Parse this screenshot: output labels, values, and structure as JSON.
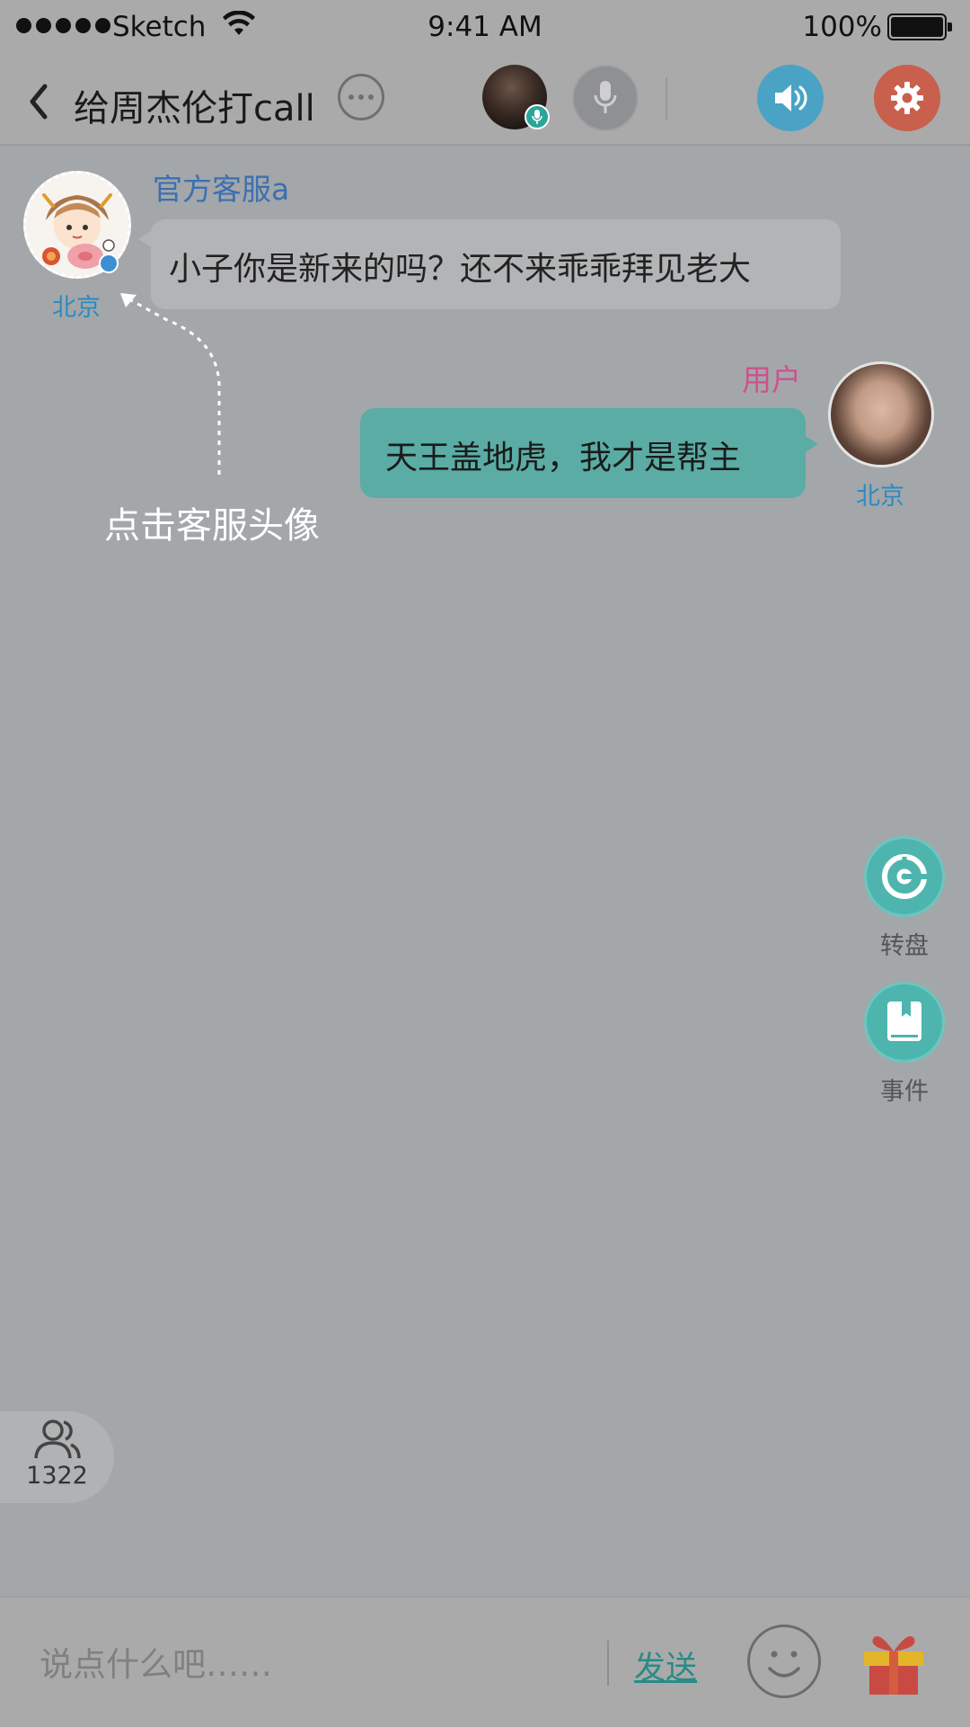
{
  "status_bar": {
    "carrier": "Sketch",
    "time": "9:41 AM",
    "battery": "100%"
  },
  "nav": {
    "title": "给周杰伦打call",
    "icons": [
      "back-icon",
      "more-icon",
      "host-avatar",
      "mic-icon",
      "speaker-icon",
      "gear-icon"
    ]
  },
  "messages": [
    {
      "sender": "官方客服a",
      "text": "小子你是新来的吗？还不来乖乖拜见老大",
      "location": "北京",
      "side": "left",
      "name_color": "#3c6fb0"
    },
    {
      "sender": "用户",
      "text": "天王盖地虎，我才是帮主",
      "location": "北京",
      "side": "right",
      "name_color": "#d0508e",
      "bubble_color": "#5aaca4"
    }
  ],
  "hint": {
    "text": "点击客服头像"
  },
  "side_actions": {
    "roulette_label": "转盘",
    "events_label": "事件"
  },
  "online": {
    "count": "1322"
  },
  "input_bar": {
    "placeholder": "说点什么吧……",
    "send_label": "发送"
  },
  "colors": {
    "overlay_background": "#a3a7aa",
    "accent_teal": "#4db5ae",
    "speaker_blue": "#4aa3c4",
    "settings_red": "#c8604d",
    "location_blue": "#2b8bc0"
  }
}
